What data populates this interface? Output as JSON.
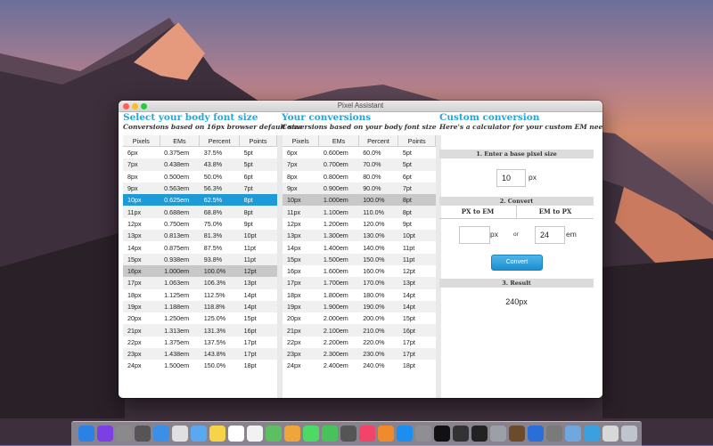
{
  "window": {
    "title": "Pixel Assistant"
  },
  "body_font": {
    "title": "Select your body font size",
    "subtitle": "Conversions based on 16px browser default size",
    "headers": [
      "Pixels",
      "EMs",
      "Percent",
      "Points"
    ],
    "selected_index": 4,
    "base_index": 10,
    "rows": [
      [
        "6px",
        "0.375em",
        "37.5%",
        "5pt"
      ],
      [
        "7px",
        "0.438em",
        "43.8%",
        "5pt"
      ],
      [
        "8px",
        "0.500em",
        "50.0%",
        "6pt"
      ],
      [
        "9px",
        "0.563em",
        "56.3%",
        "7pt"
      ],
      [
        "10px",
        "0.625em",
        "62.5%",
        "8pt"
      ],
      [
        "11px",
        "0.688em",
        "68.8%",
        "8pt"
      ],
      [
        "12px",
        "0.750em",
        "75.0%",
        "9pt"
      ],
      [
        "13px",
        "0.813em",
        "81.3%",
        "10pt"
      ],
      [
        "14px",
        "0.875em",
        "87.5%",
        "11pt"
      ],
      [
        "15px",
        "0.938em",
        "93.8%",
        "11pt"
      ],
      [
        "16px",
        "1.000em",
        "100.0%",
        "12pt"
      ],
      [
        "17px",
        "1.063em",
        "106.3%",
        "13pt"
      ],
      [
        "18px",
        "1.125em",
        "112.5%",
        "14pt"
      ],
      [
        "19px",
        "1.188em",
        "118.8%",
        "14pt"
      ],
      [
        "20px",
        "1.250em",
        "125.0%",
        "15pt"
      ],
      [
        "21px",
        "1.313em",
        "131.3%",
        "16pt"
      ],
      [
        "22px",
        "1.375em",
        "137.5%",
        "17pt"
      ],
      [
        "23px",
        "1.438em",
        "143.8%",
        "17pt"
      ],
      [
        "24px",
        "1.500em",
        "150.0%",
        "18pt"
      ]
    ]
  },
  "your_conversions": {
    "title": "Your conversions",
    "subtitle": "Conversions based on your body font size",
    "headers": [
      "Pixels",
      "EMs",
      "Percent",
      "Points"
    ],
    "base_index": 4,
    "rows": [
      [
        "6px",
        "0.600em",
        "60.0%",
        "5pt"
      ],
      [
        "7px",
        "0.700em",
        "70.0%",
        "5pt"
      ],
      [
        "8px",
        "0.800em",
        "80.0%",
        "6pt"
      ],
      [
        "9px",
        "0.900em",
        "90.0%",
        "7pt"
      ],
      [
        "10px",
        "1.000em",
        "100.0%",
        "8pt"
      ],
      [
        "11px",
        "1.100em",
        "110.0%",
        "8pt"
      ],
      [
        "12px",
        "1.200em",
        "120.0%",
        "9pt"
      ],
      [
        "13px",
        "1.300em",
        "130.0%",
        "10pt"
      ],
      [
        "14px",
        "1.400em",
        "140.0%",
        "11pt"
      ],
      [
        "15px",
        "1.500em",
        "150.0%",
        "11pt"
      ],
      [
        "16px",
        "1.600em",
        "160.0%",
        "12pt"
      ],
      [
        "17px",
        "1.700em",
        "170.0%",
        "13pt"
      ],
      [
        "18px",
        "1.800em",
        "180.0%",
        "14pt"
      ],
      [
        "19px",
        "1.900em",
        "190.0%",
        "14pt"
      ],
      [
        "20px",
        "2.000em",
        "200.0%",
        "15pt"
      ],
      [
        "21px",
        "2.100em",
        "210.0%",
        "16pt"
      ],
      [
        "22px",
        "2.200em",
        "220.0%",
        "17pt"
      ],
      [
        "23px",
        "2.300em",
        "230.0%",
        "17pt"
      ],
      [
        "24px",
        "2.400em",
        "240.0%",
        "18pt"
      ]
    ]
  },
  "custom": {
    "title": "Custom conversion",
    "subtitle": "Here's a calculator for your custom EM needs",
    "step1": "1. Enter a base pixel size",
    "base_value": "10",
    "base_unit": "px",
    "step2": "2. Convert",
    "px_to_em_label": "PX to EM",
    "em_to_px_label": "EM to PX",
    "px_input_value": "",
    "px_unit": "px",
    "or_label": "or",
    "em_input_value": "24",
    "em_unit": "em",
    "convert_label": "Convert",
    "step3": "3. Result",
    "result": "240px"
  },
  "colors": {
    "accent": "#27a4d8",
    "selected_row": "#1e9ad6",
    "button": "#1d8ed0"
  },
  "dock": {
    "icons": [
      "finder-icon",
      "siri-icon",
      "launchpad-icon",
      "mission-control-icon",
      "safari-icon",
      "photos-editor-icon",
      "mail-icon",
      "notes-icon",
      "calendar-icon",
      "reminders-icon",
      "maps-icon",
      "photos-icon",
      "messages-icon",
      "facetime-icon",
      "photo-booth-icon",
      "music-icon",
      "books-icon",
      "app-store-icon",
      "system-preferences-icon",
      "terminal-icon",
      "console-icon",
      "activity-monitor-icon",
      "disk-utility-icon",
      "chess-icon",
      "xcode-icon",
      "script-editor-icon",
      "preview-icon",
      "pixel-assistant-icon",
      "documents-icon",
      "trash-icon"
    ],
    "colors": [
      "#2a82e4",
      "#7b3fe4",
      "#8a8a8a",
      "#555555",
      "#3b8fe8",
      "#e0e0e0",
      "#5aa7f2",
      "#f7d34a",
      "#ffffff",
      "#f2f2f2",
      "#5cbf62",
      "#f0a53a",
      "#4cd964",
      "#48c25a",
      "#555555",
      "#f2446b",
      "#f08a2a",
      "#1c8ef0",
      "#8e8e93",
      "#111111",
      "#333333",
      "#222222",
      "#9aa0a6",
      "#6b4c2a",
      "#2a6fd8",
      "#7a7a7a",
      "#6fa8e0",
      "#3aa0e0",
      "#d8d8d8",
      "#bfc5cc"
    ]
  }
}
